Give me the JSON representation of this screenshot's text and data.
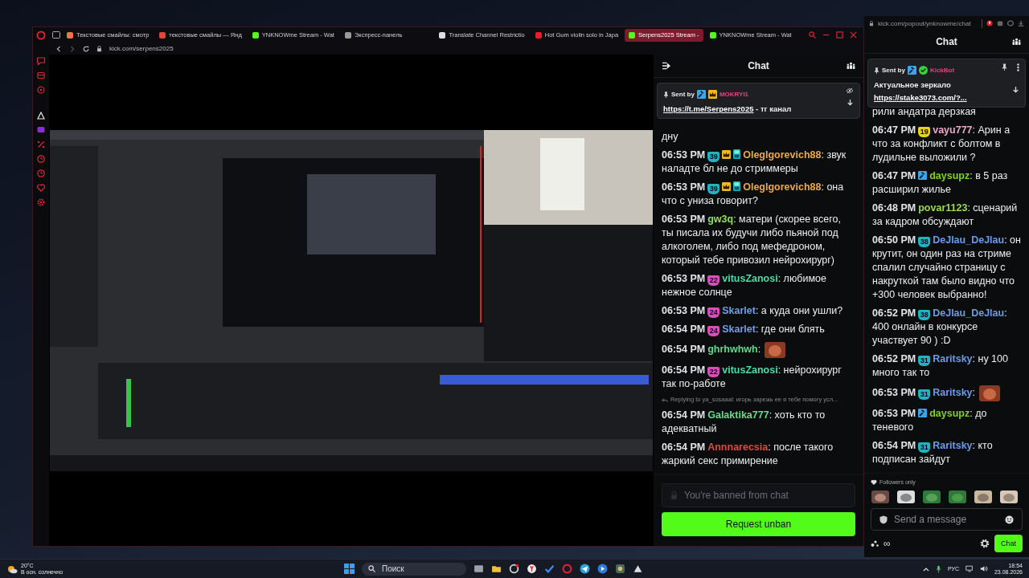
{
  "browser": {
    "tabs": [
      {
        "label": "Текстовые смайлы: смотр",
        "selected": false
      },
      {
        "label": "текстовые смайлы — Янд",
        "selected": false
      },
      {
        "label": "YNKNOWme Stream - Wat",
        "selected": false
      },
      {
        "label": "Экспресс-панель",
        "selected": false
      },
      {
        "label": "Translate Channel Restrictio",
        "selected": false
      },
      {
        "label": "Hot Gum violin solo in Japa",
        "selected": false
      },
      {
        "label": "Serpens2025 Stream -",
        "selected": true
      },
      {
        "label": "YNKNOWme Stream - Wat",
        "selected": false
      }
    ],
    "address": "kick.com/serpens2025"
  },
  "stream_chat": {
    "title": "Chat",
    "pinned": {
      "label": "Sent by",
      "badges": [
        {
          "kind": "moderator"
        },
        {
          "kind": "crown"
        }
      ],
      "user": "MOKRYI1",
      "color": "#e0457b",
      "link": "https://t.me/Serpens2025",
      "suffix": " - тг канал"
    },
    "messages": [
      {
        "kind": "continuation",
        "text": "дну"
      },
      {
        "kind": "message",
        "time": "06:53 PM",
        "badges": [
          {
            "kind": "sub",
            "label": "39",
            "color": "#1fb5c0"
          },
          {
            "kind": "crown"
          },
          {
            "kind": "og"
          }
        ],
        "user": "OlegIgorevich88",
        "color": "#f2a93b",
        "text": ": звук наладте бл не до стриммеры"
      },
      {
        "kind": "message",
        "time": "06:53 PM",
        "badges": [
          {
            "kind": "sub",
            "label": "39",
            "color": "#1fb5c0"
          },
          {
            "kind": "crown"
          },
          {
            "kind": "og"
          }
        ],
        "user": "OlegIgorevich88",
        "color": "#f2a93b",
        "text": ": она что с униза говорит?"
      },
      {
        "kind": "message",
        "time": "06:53 PM",
        "user": "gw3q",
        "color": "#8fe05a",
        "text": ": матери (скорее всего, ты писала их будучи либо пьяной под алкоголем, либо под мефедроном, который тебе привозил нейрохирург)"
      },
      {
        "kind": "message",
        "time": "06:53 PM",
        "badges": [
          {
            "kind": "sub",
            "label": "22",
            "color": "#d84fb7"
          }
        ],
        "user": "vitusZanosi",
        "color": "#4fd8a8",
        "text": ": любимое нежное солнце"
      },
      {
        "kind": "message",
        "time": "06:53 PM",
        "badges": [
          {
            "kind": "sub",
            "label": "24",
            "color": "#d84fb7"
          }
        ],
        "user": "Skarlet",
        "color": "#6f9fe8",
        "text": ": а куда они ушли?"
      },
      {
        "kind": "message",
        "time": "06:54 PM",
        "badges": [
          {
            "kind": "sub",
            "label": "24",
            "color": "#d84fb7"
          }
        ],
        "user": "Skarlet",
        "color": "#6f9fe8",
        "text": ": где они блять"
      },
      {
        "kind": "message",
        "time": "06:54 PM",
        "user": "ghrhwhwh",
        "color": "#5bdc8c",
        "text": ":",
        "emote": true
      },
      {
        "kind": "message",
        "time": "06:54 PM",
        "badges": [
          {
            "kind": "sub",
            "label": "22",
            "color": "#d84fb7"
          }
        ],
        "user": "vitusZanosi",
        "color": "#4fd8a8",
        "text": ": нейрохирург так по-работе"
      },
      {
        "kind": "reply",
        "text": "Replying to ya_sosaaal: игорь зарежь ее я тебе помогу усл..."
      },
      {
        "kind": "message",
        "time": "06:54 PM",
        "user": "Galaktika777",
        "color": "#5ee08a",
        "text": ": хоть кто то адекватный"
      },
      {
        "kind": "message",
        "time": "06:54 PM",
        "user": "Annnarecsia",
        "color": "#e8453c",
        "text": ": после такого жаркий секс примирение"
      }
    ],
    "footer": {
      "kind": "banned",
      "placeholder": "You're banned from chat",
      "button": "Request unban"
    }
  },
  "popout": {
    "address": "kick.com/popout/ynknowme/chat",
    "title": "Chat",
    "pinned": {
      "label": "Sent by",
      "badges": [
        {
          "kind": "moderator"
        },
        {
          "kind": "verified"
        }
      ],
      "user": "KickBot",
      "color": "#e0457b",
      "text": "Актуальное зеркало",
      "link": "https://stake3073.com/?..."
    },
    "messages": [
      {
        "kind": "continuation",
        "text": "рили андатра дерзкая"
      },
      {
        "kind": "message",
        "time": "06:47 PM",
        "badges": [
          {
            "kind": "sub",
            "label": "19",
            "color": "#e8d21f"
          }
        ],
        "user": "vayu777",
        "color": "#e8a8c8",
        "text": ": Арин а что за конфликт с болтом в лудильне выложили ?"
      },
      {
        "kind": "message",
        "time": "06:47 PM",
        "badges": [
          {
            "kind": "moderator"
          }
        ],
        "user": "daysupz",
        "color": "#7ed321",
        "text": ": в 5 раз расширил жилье"
      },
      {
        "kind": "message",
        "time": "06:48 PM",
        "user": "povar1123",
        "color": "#9ad94e",
        "text": ": сценарий за кадром обсуждают"
      },
      {
        "kind": "message",
        "time": "06:50 PM",
        "badges": [
          {
            "kind": "sub",
            "label": "38",
            "color": "#1fb5c0"
          }
        ],
        "user": "DeJlau_DeJlau",
        "color": "#6b9be8",
        "text": ": он крутит, он один раз на стриме спалил случайно страницу с накруткой там было видно что +300 человек выбранно!"
      },
      {
        "kind": "message",
        "time": "06:52 PM",
        "badges": [
          {
            "kind": "sub",
            "label": "38",
            "color": "#1fb5c0"
          }
        ],
        "user": "DeJlau_DeJlau",
        "color": "#6b9be8",
        "text": ": 400 онлайн в конкурсе участвует 90 ) :D"
      },
      {
        "kind": "message",
        "time": "06:52 PM",
        "badges": [
          {
            "kind": "sub",
            "label": "31",
            "color": "#1fb5c0"
          }
        ],
        "user": "Raritsky",
        "color": "#6b9be8",
        "text": ": ну 100 много так то"
      },
      {
        "kind": "message",
        "time": "06:53 PM",
        "badges": [
          {
            "kind": "sub",
            "label": "31",
            "color": "#1fb5c0"
          }
        ],
        "user": "Raritsky",
        "color": "#6b9be8",
        "text": ":",
        "emote": true
      },
      {
        "kind": "message",
        "time": "06:53 PM",
        "badges": [
          {
            "kind": "moderator"
          }
        ],
        "user": "daysupz",
        "color": "#7ed321",
        "text": ": до теневого"
      },
      {
        "kind": "message",
        "time": "06:54 PM",
        "badges": [
          {
            "kind": "sub",
            "label": "31",
            "color": "#1fb5c0"
          }
        ],
        "user": "Raritsky",
        "color": "#6b9be8",
        "text": ": кто подписан зайдут"
      }
    ],
    "footer": {
      "kind": "composer",
      "followers_label": "Followers only",
      "placeholder": "Send a message",
      "mode": "∞",
      "button": "Chat"
    }
  },
  "taskbar": {
    "temperature": "20°C",
    "weather": "В осн. солнечно",
    "search_placeholder": "Поиск",
    "language": "РУС",
    "time": "18:54",
    "date": "23.08.2026"
  }
}
